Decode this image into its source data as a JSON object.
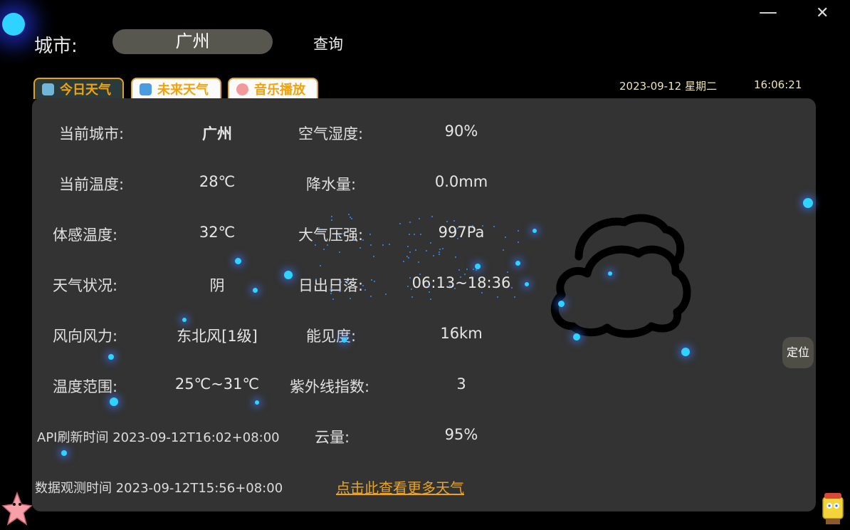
{
  "window": {
    "minimize_symbol": "—",
    "close_symbol": "✕"
  },
  "top": {
    "city_label": "城市:",
    "city_value": "广州",
    "query_label": "查询"
  },
  "tabs": [
    {
      "label": "今日天气",
      "icon": "weather-icon",
      "icon_color": "#6fb6d8",
      "active": true
    },
    {
      "label": "未来天气",
      "icon": "forecast-icon",
      "icon_color": "#4a9be0",
      "active": false
    },
    {
      "label": "音乐播放",
      "icon": "music-icon",
      "icon_color": "#f29a9a",
      "active": false
    }
  ],
  "datetime": {
    "date": "2023-09-12 星期二",
    "time": "16:06:21"
  },
  "weather": {
    "rows": [
      {
        "label1": "当前城市:",
        "value1": "广州",
        "label2": "空气湿度:",
        "value2": "90%"
      },
      {
        "label1": "当前温度:",
        "value1": "28℃",
        "label2": "降水量:",
        "value2": "0.0mm"
      },
      {
        "label1": "体感温度:",
        "value1": "32℃",
        "label2": "大气压强:",
        "value2": "997Pa"
      },
      {
        "label1": "天气状况:",
        "value1": "阴",
        "label2": "日出日落:",
        "value2": "06:13~18:36"
      },
      {
        "label1": "风向风力:",
        "value1": "东北风[1级]",
        "label2": "能见度:",
        "value2": "16km"
      },
      {
        "label1": "温度范围:",
        "value1": "25℃~31℃",
        "label2": "紫外线指数:",
        "value2": "3"
      }
    ],
    "api_refresh": "API刷新时间  2023-09-12T16:02+08:00",
    "cloud_label": "云量:",
    "cloud_value": "95%",
    "observation": "数据观测时间 2023-09-12T15:56+08:00",
    "more_link": "点击此查看更多天气"
  },
  "locate_label": "定位",
  "colors": {
    "accent": "#e8a325",
    "panel": "#333333",
    "particle": "#2ed3ff"
  }
}
